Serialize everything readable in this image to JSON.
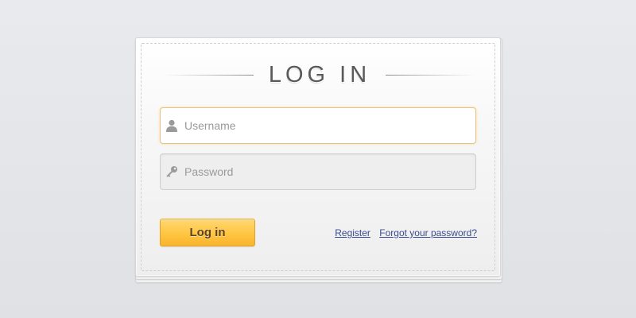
{
  "login": {
    "title": "LOG IN",
    "username": {
      "placeholder": "Username",
      "value": "",
      "icon": "user-icon"
    },
    "password": {
      "placeholder": "Password",
      "value": "",
      "icon": "key-icon"
    },
    "submit_label": "Log in",
    "register_label": "Register",
    "forgot_label": "Forgot your password?"
  },
  "colors": {
    "accent_button": "#ffc541",
    "focus_border": "#e8c283",
    "link": "#3a4d8f",
    "title": "#5a5a5a",
    "icon": "#9a9a9a"
  }
}
